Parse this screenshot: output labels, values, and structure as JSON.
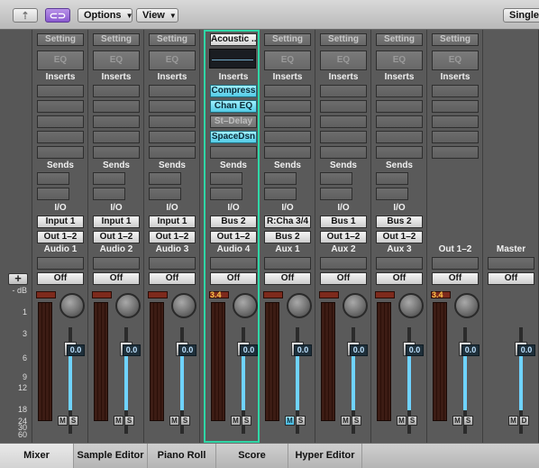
{
  "toolbar": {
    "options_label": "Options",
    "view_label": "View",
    "single_label": "Single"
  },
  "left_gutter": {
    "add_label": "+",
    "scale": [
      "- dB",
      "1",
      "3",
      "6",
      "9",
      "12",
      "18",
      "24",
      "30",
      "60"
    ]
  },
  "strips": [
    {
      "name": "Audio 1",
      "setting": "Setting",
      "eq": "EQ",
      "inserts": [],
      "io_in": "Input 1",
      "io_out": "Out 1–2",
      "auto": "Off",
      "peak": "",
      "volume": "0.0",
      "muted": false
    },
    {
      "name": "Audio 2",
      "setting": "Setting",
      "eq": "EQ",
      "inserts": [],
      "io_in": "Input 1",
      "io_out": "Out 1–2",
      "auto": "Off",
      "peak": "",
      "volume": "0.0",
      "muted": false
    },
    {
      "name": "Audio 3",
      "setting": "Setting",
      "eq": "EQ",
      "inserts": [],
      "io_in": "Input 1",
      "io_out": "Out 1–2",
      "auto": "Off",
      "peak": "",
      "volume": "0.0",
      "muted": false
    },
    {
      "name": "Audio 4",
      "setting": "Acoustic ...",
      "eq": "",
      "inserts": [
        "Compress",
        "Chan EQ",
        "St–Delay",
        "SpaceDsn"
      ],
      "io_in": "Bus 2",
      "io_out": "Out 1–2",
      "auto": "Off",
      "peak": "3.4",
      "volume": "0.0",
      "muted": false,
      "selected": true
    },
    {
      "name": "Aux 1",
      "setting": "Setting",
      "eq": "EQ",
      "inserts": [],
      "io_in": "R:Cha 3/4",
      "io_out": "Bus 2",
      "auto": "Off",
      "peak": "",
      "volume": "0.0",
      "muted": true
    },
    {
      "name": "Aux 2",
      "setting": "Setting",
      "eq": "EQ",
      "inserts": [],
      "io_in": "Bus 1",
      "io_out": "Out 1–2",
      "auto": "Off",
      "peak": "",
      "volume": "0.0",
      "muted": false
    },
    {
      "name": "Aux 3",
      "setting": "Setting",
      "eq": "EQ",
      "inserts": [],
      "io_in": "Bus 2",
      "io_out": "Out 1–2",
      "auto": "Off",
      "peak": "",
      "volume": "0.0",
      "muted": false
    },
    {
      "name": "Out 1–2",
      "setting": "Setting",
      "eq": "EQ",
      "inserts": [],
      "io_in": "",
      "io_out": "",
      "auto": "Off",
      "peak": "3.4",
      "volume": "0.0",
      "muted": false
    },
    {
      "name": "Master",
      "setting": "",
      "eq": "",
      "inserts": [],
      "io_in": "",
      "io_out": "",
      "auto": "Off",
      "peak": "",
      "volume": "0.0",
      "muted": false
    }
  ],
  "section_labels": {
    "inserts": "Inserts",
    "sends": "Sends",
    "io": "I/O"
  },
  "buttons": {
    "m": "M",
    "s": "S",
    "d": "D"
  },
  "tabs": [
    "Mixer",
    "Sample Editor",
    "Piano Roll",
    "Score",
    "Hyper Editor"
  ],
  "colors": {
    "selected_border": "#2fd6a6",
    "plugin_active": "#53cbe6",
    "accent_link": "#8a5ad0"
  }
}
